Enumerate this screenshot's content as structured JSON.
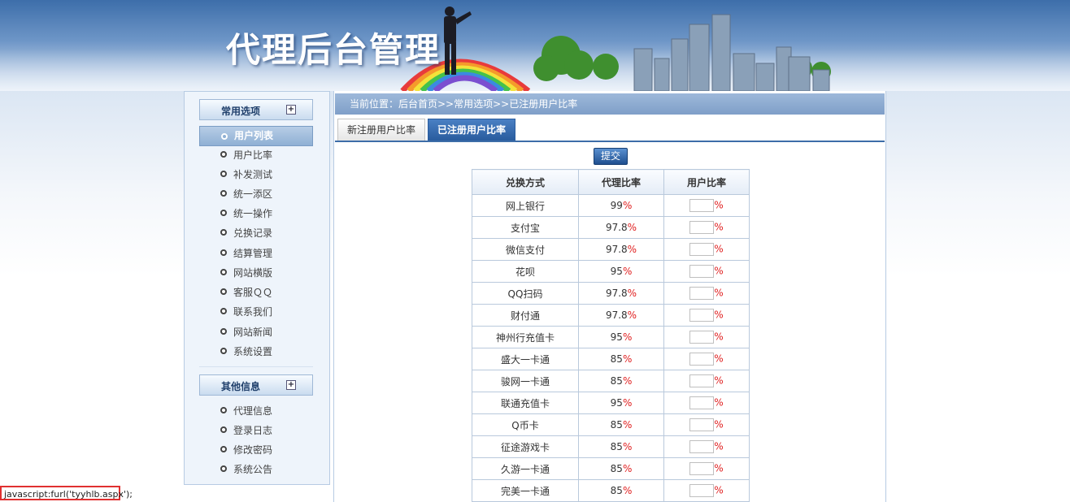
{
  "banner": {
    "title": "代理后台管理"
  },
  "sidebar": {
    "common_header": "常用选项",
    "common_items": [
      {
        "label": "用户列表",
        "active": true
      },
      {
        "label": "用户比率"
      },
      {
        "label": "补发测试"
      },
      {
        "label": "统一添区"
      },
      {
        "label": "统一操作"
      },
      {
        "label": "兑换记录"
      },
      {
        "label": "结算管理"
      },
      {
        "label": "网站横版"
      },
      {
        "label": "客服ＱＱ"
      },
      {
        "label": "联系我们"
      },
      {
        "label": "网站新闻"
      },
      {
        "label": "系统设置"
      }
    ],
    "other_header": "其他信息",
    "other_items": [
      {
        "label": "代理信息"
      },
      {
        "label": "登录日志"
      },
      {
        "label": "修改密码"
      },
      {
        "label": "系统公告"
      }
    ],
    "expand_symbol": "+"
  },
  "main": {
    "breadcrumb": "当前位置：后台首页>>常用选项>>已注册用户比率",
    "tabs": [
      {
        "label": "新注册用户比率",
        "active": false
      },
      {
        "label": "已注册用户比率",
        "active": true
      }
    ],
    "submit_label": "提交",
    "table": {
      "headers": [
        "兑换方式",
        "代理比率",
        "用户比率"
      ],
      "percent_sign": "%",
      "rows": [
        {
          "method": "网上银行",
          "agent_rate": "99",
          "user_rate": ""
        },
        {
          "method": "支付宝",
          "agent_rate": "97.8",
          "user_rate": ""
        },
        {
          "method": "微信支付",
          "agent_rate": "97.8",
          "user_rate": ""
        },
        {
          "method": "花呗",
          "agent_rate": "95",
          "user_rate": ""
        },
        {
          "method": "QQ扫码",
          "agent_rate": "97.8",
          "user_rate": ""
        },
        {
          "method": "财付通",
          "agent_rate": "97.8",
          "user_rate": ""
        },
        {
          "method": "神州行充值卡",
          "agent_rate": "95",
          "user_rate": ""
        },
        {
          "method": "盛大一卡通",
          "agent_rate": "85",
          "user_rate": ""
        },
        {
          "method": "骏网一卡通",
          "agent_rate": "85",
          "user_rate": ""
        },
        {
          "method": "联通充值卡",
          "agent_rate": "95",
          "user_rate": ""
        },
        {
          "method": "Q币卡",
          "agent_rate": "85",
          "user_rate": ""
        },
        {
          "method": "征途游戏卡",
          "agent_rate": "85",
          "user_rate": ""
        },
        {
          "method": "久游一卡通",
          "agent_rate": "85",
          "user_rate": ""
        },
        {
          "method": "完美一卡通",
          "agent_rate": "85",
          "user_rate": ""
        }
      ]
    }
  },
  "statusbar": {
    "text": "javascript:furl('tyyhlb.aspx');"
  },
  "colors": {
    "accent": "#2a5d9f",
    "percent": "#e02020",
    "status_border": "#e03030"
  }
}
